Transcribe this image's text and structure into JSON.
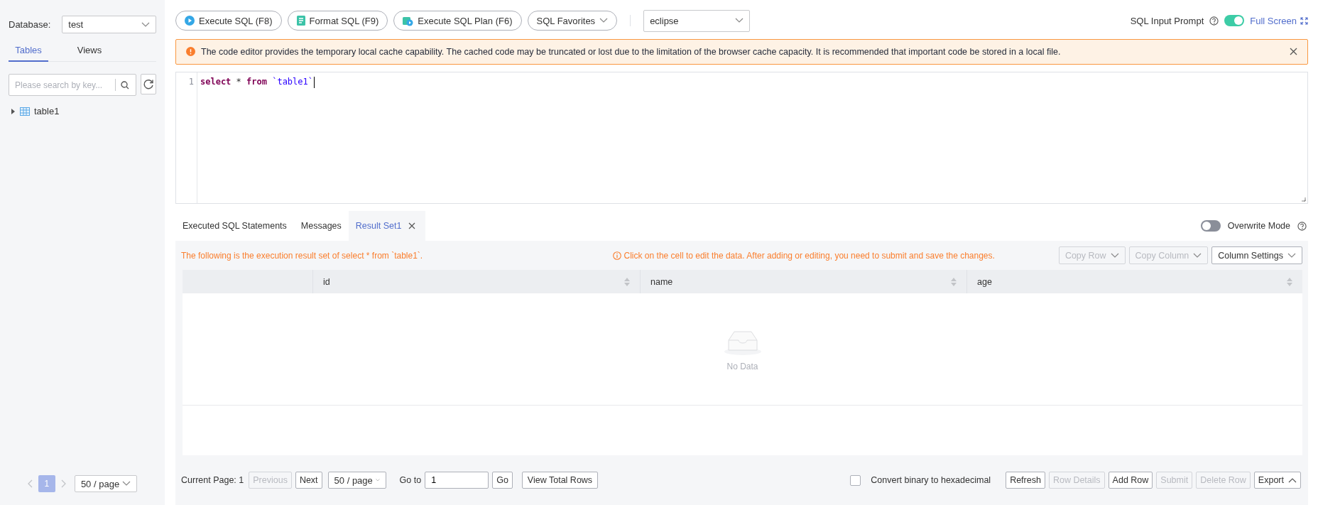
{
  "sidebar": {
    "database_label": "Database:",
    "database_value": "test",
    "tabs": [
      {
        "label": "Tables",
        "selected": true
      },
      {
        "label": "Views",
        "selected": false
      }
    ],
    "search": {
      "placeholder": "Please search by key..."
    },
    "tree": [
      {
        "label": "table1",
        "expanded": false
      }
    ],
    "pagination": {
      "pages": [
        {
          "label": "1",
          "selected": true
        }
      ],
      "page_size": "50 / page"
    }
  },
  "toolbar": {
    "buttons": [
      {
        "label": "Execute SQL (F8)",
        "kind": "run"
      },
      {
        "label": "Format SQL (F9)",
        "kind": "format"
      },
      {
        "label": "Execute SQL Plan (F6)",
        "kind": "plan"
      },
      {
        "label": "SQL Favorites",
        "kind": "dropdown"
      }
    ],
    "theme": "eclipse",
    "sql_input_prompt": {
      "label": "SQL Input Prompt",
      "on": true
    },
    "full_screen": "Full Screen"
  },
  "alert": "The code editor provides the temporary local cache capability. The cached code may be truncated or lost due to the limitation of the browser cache capacity. It is recommended that important code be stored in a local file.",
  "editor": {
    "lines": [
      {
        "number": "1",
        "tokens": [
          {
            "text": "select",
            "kind": "keyword"
          },
          {
            "text": " * ",
            "kind": "plain"
          },
          {
            "text": "from",
            "kind": "keyword"
          },
          {
            "text": " `table1`",
            "kind": "identifier"
          }
        ]
      }
    ]
  },
  "results": {
    "tabs": [
      {
        "label": "Executed SQL Statements",
        "selected": false,
        "closable": false
      },
      {
        "label": "Messages",
        "selected": false,
        "closable": false
      },
      {
        "label": "Result Set1",
        "selected": true,
        "closable": true
      }
    ],
    "overwrite_mode": {
      "label": "Overwrite Mode",
      "on": false
    },
    "summary": "The following is the execution result set of select * from `table1`.",
    "hint": "Click on the cell to edit the data. After adding or editing, you need to submit and save the changes.",
    "actions": [
      {
        "label": "Copy Row",
        "disabled": true
      },
      {
        "label": "Copy Column",
        "disabled": true
      },
      {
        "label": "Column Settings",
        "disabled": false
      }
    ],
    "table": {
      "columns": [
        "id",
        "name",
        "age"
      ],
      "empty_text": "No Data"
    },
    "footer": {
      "current_page": "Current Page: 1",
      "nav": [
        {
          "label": "Previous",
          "disabled": true
        },
        {
          "label": "Next",
          "disabled": false
        }
      ],
      "page_size": "50 / page",
      "goto_label": "Go to",
      "goto_value": "1",
      "go": "Go",
      "view_total": "View Total Rows",
      "convert": {
        "label": "Convert binary to hexadecimal",
        "checked": false
      },
      "buttons": [
        {
          "label": "Refresh",
          "disabled": false,
          "kind": "plain"
        },
        {
          "label": "Row Details",
          "disabled": true,
          "kind": "plain"
        },
        {
          "label": "Add Row",
          "disabled": false,
          "kind": "plain"
        },
        {
          "label": "Submit",
          "disabled": true,
          "kind": "plain"
        },
        {
          "label": "Delete Row",
          "disabled": true,
          "kind": "plain"
        },
        {
          "label": "Export",
          "disabled": false,
          "kind": "menu"
        }
      ]
    }
  }
}
